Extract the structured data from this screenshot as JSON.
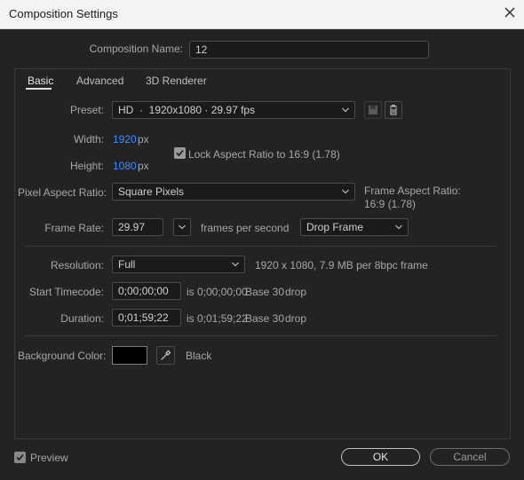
{
  "window": {
    "title": "Composition Settings",
    "close_icon": "close-icon"
  },
  "comp_name": {
    "label": "Composition Name:",
    "value": "12"
  },
  "tabs": [
    {
      "label": "Basic",
      "active": true
    },
    {
      "label": "Advanced",
      "active": false
    },
    {
      "label": "3D Renderer",
      "active": false
    }
  ],
  "basic": {
    "preset": {
      "label": "Preset:",
      "value": "HD  ·  1920x1080 · 29.97 fps",
      "icons": [
        "save-preset-icon",
        "trash-icon"
      ]
    },
    "width": {
      "label": "Width:",
      "value": "1920",
      "unit": "px"
    },
    "height": {
      "label": "Height:",
      "value": "1080",
      "unit": "px"
    },
    "lock_aspect": {
      "label": "Lock Aspect Ratio to 16:9 (1.78)",
      "checked": true
    },
    "pixel_aspect": {
      "label": "Pixel Aspect Ratio:",
      "value": "Square Pixels"
    },
    "frame_aspect": {
      "label": "Frame Aspect Ratio:",
      "value": "16:9 (1.78)"
    },
    "frame_rate": {
      "label": "Frame Rate:",
      "value": "29.97",
      "unit_label": "frames per second",
      "drop_frame_value": "Drop Frame"
    },
    "resolution": {
      "label": "Resolution:",
      "value": "Full",
      "info": "1920 x 1080, 7.9 MB per 8bpc frame"
    },
    "start_timecode": {
      "label": "Start Timecode:",
      "value": "0;00;00;00",
      "is_text": "is 0;00;00;00",
      "base": "Base 30",
      "drop": "drop"
    },
    "duration": {
      "label": "Duration:",
      "value": "0;01;59;22",
      "is_text": "is 0;01;59;22",
      "base": "Base 30",
      "drop": "drop"
    },
    "background": {
      "label": "Background Color:",
      "swatch_color": "#000000",
      "color_name": "Black",
      "eyedropper_icon": "eyedropper-icon"
    }
  },
  "footer": {
    "preview_label": "Preview",
    "preview_checked": true,
    "ok_label": "OK",
    "cancel_label": "Cancel"
  },
  "colors": {
    "accent_blue": "#3a8bff",
    "dialog_bg": "#232323",
    "titlebar_bg": "#f3f3f3"
  }
}
